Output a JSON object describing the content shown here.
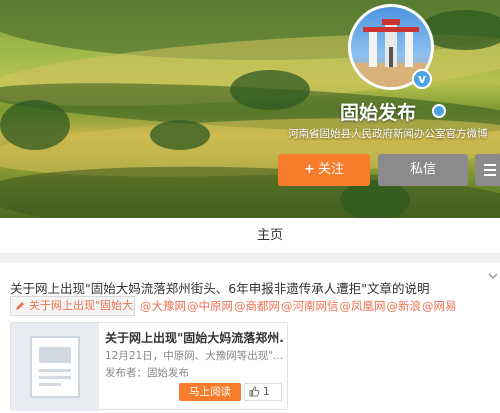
{
  "profile": {
    "name": "固始发布",
    "description": "河南省固始县人民政府新闻办公室官方微博",
    "follow_label": "关注",
    "follow_plus": "+",
    "message_label": "私信"
  },
  "tabs": {
    "home_label": "主页"
  },
  "post": {
    "title": "关于网上出现\"固始大妈流落郑州街头、6年申报非遗传承人遭拒\"文章的说明",
    "source_chip": "关于网上出现\"固始大妈流落郑州",
    "mentions": [
      "@大豫网",
      "@中原网",
      "@商都网",
      "@河南网信",
      "@凤凰网",
      "@新浪",
      "@网易"
    ]
  },
  "card": {
    "title": "关于网上出现\"固始大妈流落郑州...",
    "meta": "12月21日，中原网、大豫网等出现\"...",
    "author": "发布者：固始发布",
    "read_label": "马上阅读",
    "like_count": "1"
  },
  "colors": {
    "accent": "#f77c2b",
    "link": "#eb7350",
    "verified": "#4ba3e3"
  }
}
